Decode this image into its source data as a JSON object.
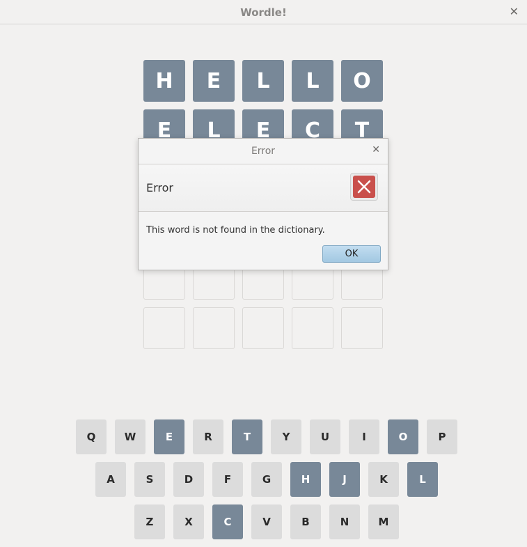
{
  "window": {
    "title": "Wordle!",
    "close_glyph": "✕"
  },
  "board": {
    "rows": [
      [
        "H",
        "E",
        "L",
        "L",
        "O"
      ],
      [
        "E",
        "L",
        "E",
        "C",
        "T"
      ],
      [
        "",
        "",
        "",
        "",
        ""
      ],
      [
        "",
        "",
        "",
        "",
        ""
      ],
      [
        "",
        "",
        "",
        "",
        ""
      ],
      [
        "",
        "",
        "",
        "",
        ""
      ]
    ]
  },
  "keyboard": {
    "rows": [
      [
        {
          "k": "Q",
          "used": false
        },
        {
          "k": "W",
          "used": false
        },
        {
          "k": "E",
          "used": true
        },
        {
          "k": "R",
          "used": false
        },
        {
          "k": "T",
          "used": true
        },
        {
          "k": "Y",
          "used": false
        },
        {
          "k": "U",
          "used": false
        },
        {
          "k": "I",
          "used": false
        },
        {
          "k": "O",
          "used": true
        },
        {
          "k": "P",
          "used": false
        }
      ],
      [
        {
          "k": "A",
          "used": false
        },
        {
          "k": "S",
          "used": false
        },
        {
          "k": "D",
          "used": false
        },
        {
          "k": "F",
          "used": false
        },
        {
          "k": "G",
          "used": false
        },
        {
          "k": "H",
          "used": true
        },
        {
          "k": "J",
          "used": true
        },
        {
          "k": "K",
          "used": false
        },
        {
          "k": "L",
          "used": true
        }
      ],
      [
        {
          "k": "Z",
          "used": false
        },
        {
          "k": "X",
          "used": false
        },
        {
          "k": "C",
          "used": true
        },
        {
          "k": "V",
          "used": false
        },
        {
          "k": "B",
          "used": false
        },
        {
          "k": "N",
          "used": false
        },
        {
          "k": "M",
          "used": false
        }
      ]
    ]
  },
  "dialog": {
    "title": "Error",
    "close_glyph": "✕",
    "header": "Error",
    "icon": "error-x-icon",
    "message": "This word is not found in the dictionary.",
    "ok_label": "OK"
  },
  "colors": {
    "tile_filled": "#788898",
    "key_default": "#dcdcdc",
    "error_icon": "#c9504c"
  }
}
